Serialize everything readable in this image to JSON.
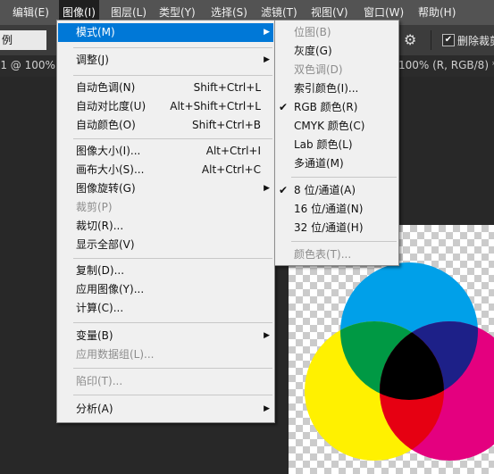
{
  "menubar": {
    "items": [
      {
        "label": "编辑(E)"
      },
      {
        "label": "图像(I)"
      },
      {
        "label": "图层(L)"
      },
      {
        "label": "类型(Y)"
      },
      {
        "label": "选择(S)"
      },
      {
        "label": "滤镜(T)"
      },
      {
        "label": "视图(V)"
      },
      {
        "label": "窗口(W)"
      },
      {
        "label": "帮助(H)"
      }
    ]
  },
  "options_bar": {
    "left_field": "例",
    "gear_icon": "gear-icon",
    "delete_cropped_checked": true,
    "delete_cropped_label": "删除裁剪"
  },
  "tabbar": {
    "left_text": "-1 @ 100%",
    "right_text": "100% (R, RGB/8) *"
  },
  "image_menu": {
    "items": [
      {
        "label": "模式(M)",
        "shortcut": "",
        "submenu": true,
        "disabled": false,
        "highlighted": true
      },
      {
        "label": "调整(J)",
        "shortcut": "",
        "submenu": true,
        "disabled": false
      },
      {
        "label": "自动色调(N)",
        "shortcut": "Shift+Ctrl+L",
        "submenu": false,
        "disabled": false
      },
      {
        "label": "自动对比度(U)",
        "shortcut": "Alt+Shift+Ctrl+L",
        "submenu": false,
        "disabled": false
      },
      {
        "label": "自动颜色(O)",
        "shortcut": "Shift+Ctrl+B",
        "submenu": false,
        "disabled": false
      },
      {
        "label": "图像大小(I)...",
        "shortcut": "Alt+Ctrl+I",
        "submenu": false,
        "disabled": false
      },
      {
        "label": "画布大小(S)...",
        "shortcut": "Alt+Ctrl+C",
        "submenu": false,
        "disabled": false
      },
      {
        "label": "图像旋转(G)",
        "shortcut": "",
        "submenu": true,
        "disabled": false
      },
      {
        "label": "裁剪(P)",
        "shortcut": "",
        "submenu": false,
        "disabled": true
      },
      {
        "label": "裁切(R)...",
        "shortcut": "",
        "submenu": false,
        "disabled": false
      },
      {
        "label": "显示全部(V)",
        "shortcut": "",
        "submenu": false,
        "disabled": false
      },
      {
        "label": "复制(D)...",
        "shortcut": "",
        "submenu": false,
        "disabled": false
      },
      {
        "label": "应用图像(Y)...",
        "shortcut": "",
        "submenu": false,
        "disabled": false
      },
      {
        "label": "计算(C)...",
        "shortcut": "",
        "submenu": false,
        "disabled": false
      },
      {
        "label": "变量(B)",
        "shortcut": "",
        "submenu": true,
        "disabled": false
      },
      {
        "label": "应用数据组(L)...",
        "shortcut": "",
        "submenu": false,
        "disabled": true
      },
      {
        "label": "陷印(T)...",
        "shortcut": "",
        "submenu": false,
        "disabled": true
      },
      {
        "label": "分析(A)",
        "shortcut": "",
        "submenu": true,
        "disabled": false
      }
    ]
  },
  "mode_submenu": {
    "items": [
      {
        "label": "位图(B)",
        "checked": false,
        "disabled": true
      },
      {
        "label": "灰度(G)",
        "checked": false,
        "disabled": false
      },
      {
        "label": "双色调(D)",
        "checked": false,
        "disabled": true
      },
      {
        "label": "索引颜色(I)...",
        "checked": false,
        "disabled": false
      },
      {
        "label": "RGB 颜色(R)",
        "checked": true,
        "disabled": false
      },
      {
        "label": "CMYK 颜色(C)",
        "checked": false,
        "disabled": false
      },
      {
        "label": "Lab 颜色(L)",
        "checked": false,
        "disabled": false
      },
      {
        "label": "多通道(M)",
        "checked": false,
        "disabled": false
      },
      {
        "label": "8 位/通道(A)",
        "checked": true,
        "disabled": false
      },
      {
        "label": "16 位/通道(N)",
        "checked": false,
        "disabled": false
      },
      {
        "label": "32 位/通道(H)",
        "checked": false,
        "disabled": false
      },
      {
        "label": "颜色表(T)...",
        "checked": false,
        "disabled": true
      }
    ]
  },
  "colors": {
    "menubar_bg": "#535353",
    "highlight": "#0078d7",
    "cyan": "#00a0e9",
    "magenta": "#e4007f",
    "yellow": "#fff100"
  }
}
